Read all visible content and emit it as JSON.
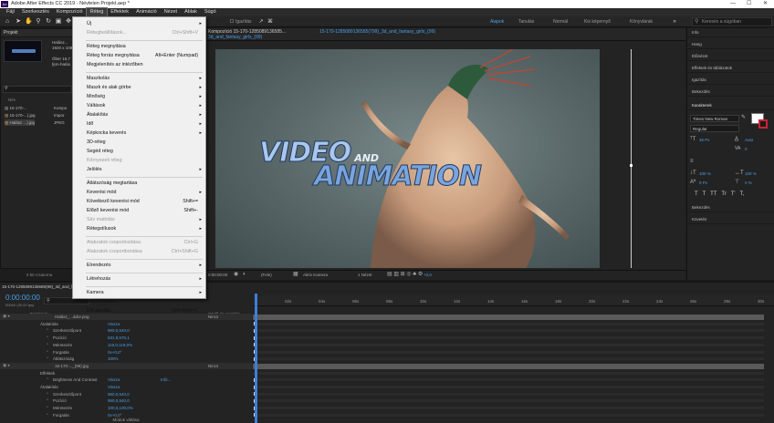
{
  "window": {
    "title": "Adobe After Effects CC 2019 - Névtelen Projekt.aep *",
    "app_icon": "Ae"
  },
  "menubar": [
    "Fájl",
    "Szerkesztés",
    "Kompozíció",
    "Réteg",
    "Effektek",
    "Animáció",
    "Nézet",
    "Ablak",
    "Súgó"
  ],
  "menubar_active": "Réteg",
  "toolbar": {
    "snap_label": "Igazítás",
    "workspaces": [
      "Alapok",
      "Tanulás",
      "Normál",
      "Kis képernyő",
      "Könyvtárak"
    ],
    "active_workspace": "Alapok",
    "search_placeholder": "Keresés a súgóban"
  },
  "project_panel": {
    "tab": "Projekt",
    "comp_name": "Halász...",
    "comp_info": [
      "1920 x 108",
      "Δ 0;00;10;00",
      "Öber 16,7 ...",
      "fem-hatás"
    ],
    "columns": [
      "Név"
    ],
    "items": [
      "15-170-...",
      "15-170-...).jpg",
      "Halász ...).jpg"
    ],
    "types": [
      "Kompo",
      "Impor",
      "JPEG"
    ],
    "bpc": "8 bit-Csatorna"
  },
  "viewer": {
    "comp_tab": "Kompozíció 15-170-1285089136585...",
    "layer_tab": "15-170-1285089136585(799)_3d_and_fantasy_girls_(99)",
    "breadcrumb": "3d_and_fantasy_girls_(99)",
    "overlay_line1": "VIDEO",
    "overlay_and": "AND",
    "overlay_line2": "ANIMATION",
    "timecode": "0:00:00:00",
    "resolution": "(Fele)",
    "camera": "Aktív Kamera",
    "views": "1 Nézet",
    "exposure": "+0,0"
  },
  "right_panel": {
    "items": [
      "Info",
      "Hang",
      "Előnézet",
      "Effektek és táblázatok",
      "Igazítás",
      "Bekezdés",
      "Karakterek"
    ],
    "font_name": "Times New Roman",
    "font_style": "Regular",
    "font_size": "36 Px",
    "leading": "Auto",
    "tracking": "0",
    "v_scale": "100 %",
    "h_scale": "100 %",
    "baseline": "0 Px",
    "tsume": "0 %",
    "lower_items": [
      "Bekezdés",
      "Követés"
    ],
    "style_buttons": [
      "T",
      "T",
      "TT",
      "Tr",
      "T'",
      "T,"
    ]
  },
  "timeline": {
    "comp_tab": "15-170-1285089136585(99)_3d_and_fantasy_girls_(99)",
    "timecode": "0:00:00:00",
    "fps": "00000 (30.00 fps)",
    "columns": [
      "Forrásnév",
      "Szülő és csatolás"
    ],
    "ruler": [
      "02s",
      "04s",
      "06s",
      "08s",
      "10s",
      "12s",
      "14s",
      "16s",
      "18s",
      "20s",
      "22s",
      "24s",
      "26s",
      "28s",
      "30s"
    ],
    "rows": [
      {
        "name": "Halász_...ádor.png",
        "value": "",
        "parent": "Nincs",
        "indent": 0,
        "layer": true
      },
      {
        "name": "Átalakítás",
        "value": "Vissza",
        "parent": "",
        "indent": 1
      },
      {
        "name": "Szerkesztőpont",
        "value": "960,0,540,0",
        "parent": "",
        "indent": 2
      },
      {
        "name": "Pozíció",
        "value": "631,9,570,1",
        "parent": "",
        "indent": 2
      },
      {
        "name": "Méretezés",
        "value": "119,0,119,0%",
        "parent": "",
        "indent": 2
      },
      {
        "name": "Forgatás",
        "value": "0x+0,0°",
        "parent": "",
        "indent": 2
      },
      {
        "name": "Átlátszóság",
        "value": "100%",
        "parent": "",
        "indent": 2
      },
      {
        "name": "15-170-..._(99).jpg",
        "value": "",
        "parent": "Nincs",
        "indent": 0,
        "layer": true
      },
      {
        "name": "Effektek",
        "value": "",
        "parent": "",
        "indent": 1
      },
      {
        "name": "Brightness And Contrast",
        "value": "Vissza",
        "parent": "",
        "indent": 2
      },
      {
        "name": "Átalakítás",
        "value": "Vissza",
        "parent": "",
        "indent": 1
      },
      {
        "name": "Szerkesztőpont",
        "value": "960,0,540,0",
        "parent": "",
        "indent": 2
      },
      {
        "name": "Pozíció",
        "value": "960,0,540,0",
        "parent": "",
        "indent": 2
      },
      {
        "name": "Méretezés",
        "value": "100,0,100,0%",
        "parent": "",
        "indent": 2
      },
      {
        "name": "Forgatás",
        "value": "0x+0,0°",
        "parent": "",
        "indent": 2
      }
    ],
    "brightness_extra": "Infó...",
    "footer": "Módok váltása"
  },
  "menu": {
    "items": [
      {
        "label": "Új",
        "shortcut": "",
        "sub": true,
        "disabled": false
      },
      {
        "label": "Rétegbeállítások...",
        "shortcut": "Ctrl+Shift+V",
        "sub": false,
        "disabled": true
      },
      {
        "sep": true
      },
      {
        "label": "Réteg megnyitása",
        "shortcut": "",
        "sub": false,
        "disabled": false
      },
      {
        "label": "Réteg forrás megnyitása",
        "shortcut": "Alt+Enter (Numpad)",
        "sub": false,
        "disabled": false
      },
      {
        "label": "Megjelenítés az intézőben",
        "shortcut": "",
        "sub": false,
        "disabled": false
      },
      {
        "sep": true
      },
      {
        "label": "Maszkolás",
        "shortcut": "",
        "sub": true,
        "disabled": false
      },
      {
        "label": "Maszk és alak görbe",
        "shortcut": "",
        "sub": true,
        "disabled": false
      },
      {
        "label": "Minőség",
        "shortcut": "",
        "sub": true,
        "disabled": false
      },
      {
        "label": "Váltások",
        "shortcut": "",
        "sub": true,
        "disabled": false
      },
      {
        "label": "Átalakítás",
        "shortcut": "",
        "sub": true,
        "disabled": false
      },
      {
        "label": "Idő",
        "shortcut": "",
        "sub": true,
        "disabled": false
      },
      {
        "label": "Képkocka keverés",
        "shortcut": "",
        "sub": true,
        "disabled": false
      },
      {
        "label": "3D-réteg",
        "shortcut": "",
        "sub": false,
        "disabled": false
      },
      {
        "label": "Segéd réteg",
        "shortcut": "",
        "sub": false,
        "disabled": false
      },
      {
        "label": "Környezeti réteg",
        "shortcut": "",
        "sub": false,
        "disabled": true
      },
      {
        "label": "Jelölés",
        "shortcut": "",
        "sub": true,
        "disabled": false
      },
      {
        "sep": true
      },
      {
        "label": "Átlátszóság megtartása",
        "shortcut": "",
        "sub": false,
        "disabled": false
      },
      {
        "label": "Keverési mód",
        "shortcut": "",
        "sub": true,
        "disabled": false
      },
      {
        "label": "Következő keverési mód",
        "shortcut": "Shift+=",
        "sub": false,
        "disabled": false
      },
      {
        "label": "Előző keverési mód",
        "shortcut": "Shift+-",
        "sub": false,
        "disabled": false
      },
      {
        "label": "Sáv mattolás",
        "shortcut": "",
        "sub": true,
        "disabled": true
      },
      {
        "label": "Rétegstílusok",
        "shortcut": "",
        "sub": true,
        "disabled": false
      },
      {
        "sep": true
      },
      {
        "label": "Alakzatok csoportosítása",
        "shortcut": "Ctrl+G",
        "sub": false,
        "disabled": true
      },
      {
        "label": "Alakzatok csoportbontása",
        "shortcut": "Ctrl+Shift+G",
        "sub": false,
        "disabled": true
      },
      {
        "sep": true
      },
      {
        "label": "Elrendezés",
        "shortcut": "",
        "sub": true,
        "disabled": false
      },
      {
        "sep": true
      },
      {
        "label": "Létrehozás",
        "shortcut": "",
        "sub": true,
        "disabled": false
      },
      {
        "sep": true
      },
      {
        "label": "Kamera",
        "shortcut": "",
        "sub": true,
        "disabled": false
      },
      {
        "label": "Autó követés...",
        "shortcut": "",
        "sub": false,
        "disabled": false
      },
      {
        "label": "Elő alkotás...",
        "shortcut": "Ctrl+Shift+C",
        "sub": false,
        "disabled": false
      }
    ]
  }
}
